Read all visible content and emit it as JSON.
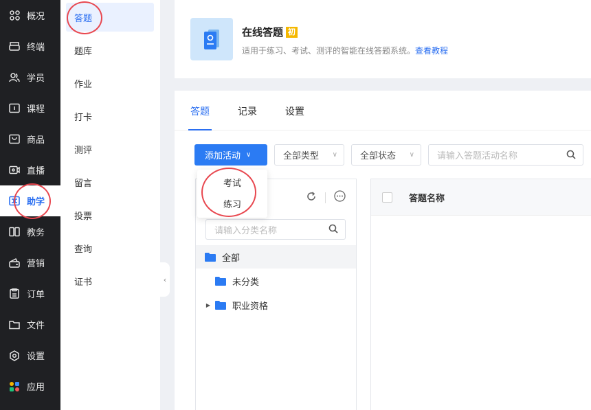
{
  "nav": {
    "items": [
      {
        "label": "概况",
        "icon": "dashboard-icon"
      },
      {
        "label": "终端",
        "icon": "terminal-icon"
      },
      {
        "label": "学员",
        "icon": "students-icon"
      },
      {
        "label": "课程",
        "icon": "course-icon"
      },
      {
        "label": "商品",
        "icon": "goods-icon"
      },
      {
        "label": "直播",
        "icon": "live-icon"
      },
      {
        "label": "助学",
        "icon": "study-assist-icon"
      },
      {
        "label": "教务",
        "icon": "academic-icon"
      },
      {
        "label": "营销",
        "icon": "marketing-icon"
      },
      {
        "label": "订单",
        "icon": "order-icon"
      },
      {
        "label": "文件",
        "icon": "folder-icon"
      },
      {
        "label": "设置",
        "icon": "settings-icon"
      },
      {
        "label": "应用",
        "icon": "apps-icon"
      }
    ],
    "active_index": 6
  },
  "subnav": {
    "items": [
      "答题",
      "题库",
      "作业",
      "打卡",
      "测评",
      "留言",
      "投票",
      "查询",
      "证书"
    ],
    "active_index": 0
  },
  "header": {
    "title": "在线答题",
    "badge": "初",
    "description": "适用于练习、考试、测评的智能在线答题系统。",
    "link": "查看教程"
  },
  "tabs": [
    "答题",
    "记录",
    "设置"
  ],
  "toolbar": {
    "add_label": "添加活动",
    "type_filter": "全部类型",
    "status_filter": "全部状态",
    "search_placeholder": "请输入答题活动名称"
  },
  "dropdown": {
    "items": [
      "考试",
      "练习"
    ]
  },
  "category": {
    "search_placeholder": "请输入分类名称",
    "tree": [
      "全部",
      "未分类",
      "职业资格"
    ]
  },
  "table": {
    "columns": [
      "答题名称"
    ]
  },
  "colors": {
    "primary": "#2b7bf3",
    "nav_bg": "#1f2023",
    "annotation": "#e8474f"
  }
}
